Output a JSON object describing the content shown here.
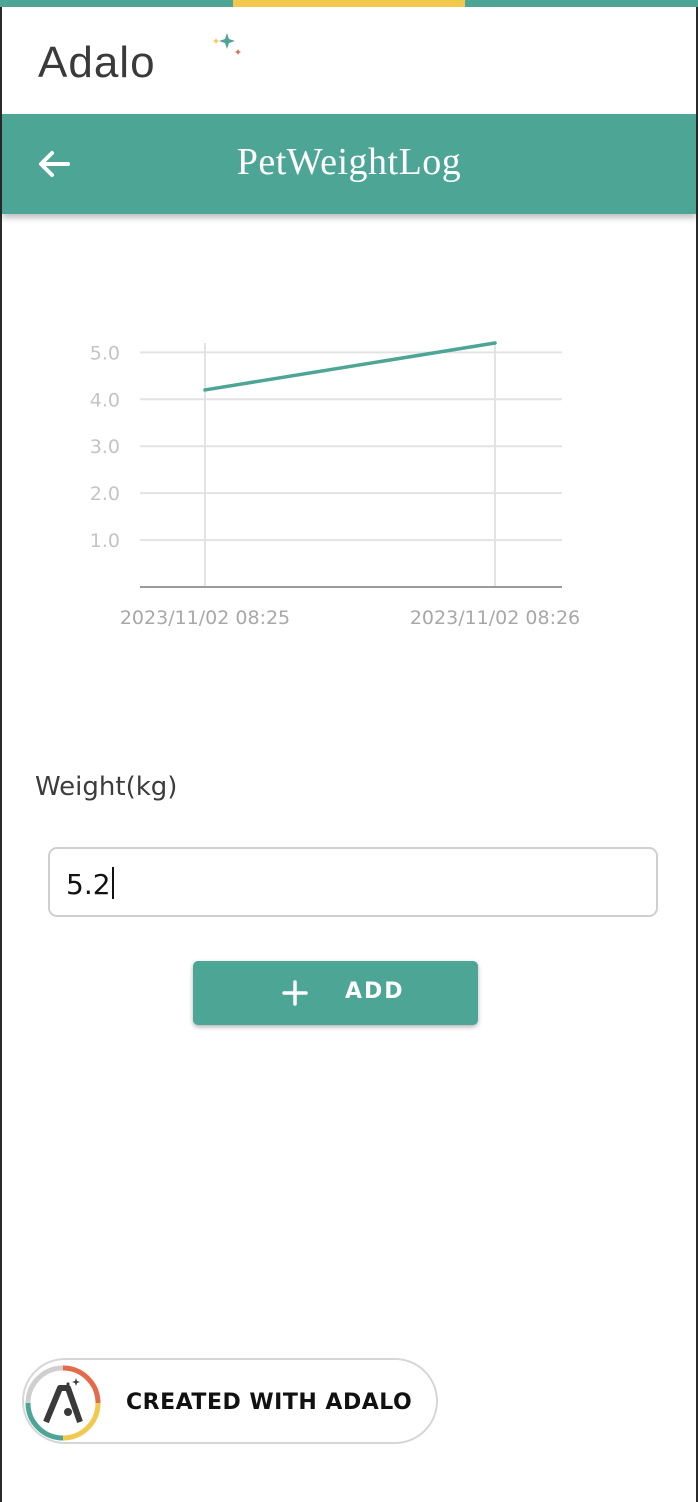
{
  "colors": {
    "teal": "#4da596",
    "yellow": "#f2c94c",
    "grid": "#e3e3e3",
    "tick": "#c4c4c4",
    "axis": "#9a9a9a",
    "line": "#4da596"
  },
  "brand": {
    "name": "Adalo"
  },
  "header": {
    "title": "PetWeightLog",
    "back_icon": "arrow-left-icon"
  },
  "form": {
    "weight_label": "Weight(kg)",
    "weight_value": "5.2",
    "add_label": "ADD",
    "add_icon": "plus-icon"
  },
  "footer": {
    "badge_label": "CREATED WITH ADALO"
  },
  "chart_data": {
    "type": "line",
    "categories": [
      "2023/11/02 08:25",
      "2023/11/02 08:26"
    ],
    "series": [
      {
        "values": [
          4.2,
          5.2
        ]
      }
    ],
    "yticks": [
      "1.0",
      "2.0",
      "3.0",
      "4.0",
      "5.0"
    ],
    "ylim": [
      0,
      5.2
    ],
    "grid": true
  }
}
